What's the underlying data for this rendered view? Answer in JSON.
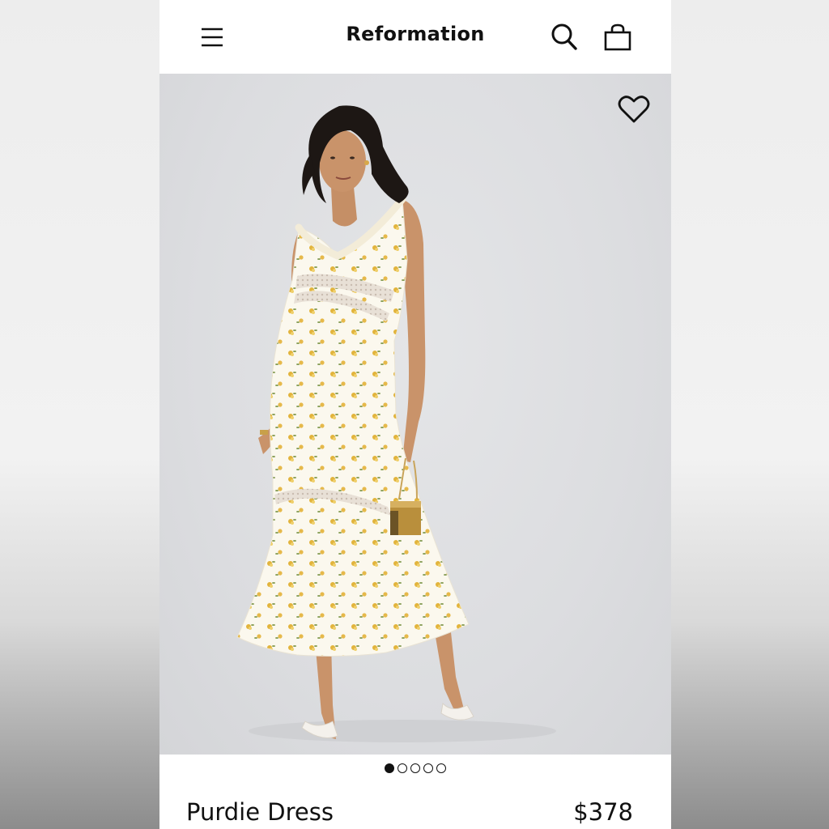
{
  "header": {
    "brand": "Reformation",
    "menu_icon": "hamburger-menu-icon",
    "search_icon": "search-icon",
    "bag_icon": "shopping-bag-icon"
  },
  "hero": {
    "image_description_icon": "product-photo",
    "favorite_icon": "heart-outline-icon",
    "carousel": {
      "total": 5,
      "active_index": 0
    }
  },
  "product": {
    "name": "Purdie Dress",
    "price": "$378"
  },
  "colors": {
    "text": "#111111",
    "photo_background": "#dcdde0",
    "dress": "#fbf8ee",
    "floral_accent": "#e2b43c"
  }
}
